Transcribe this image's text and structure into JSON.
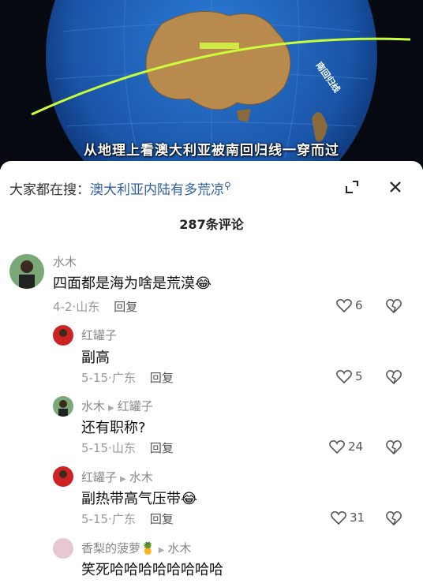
{
  "video": {
    "subtitle": "从地理上看澳大利亚被南回归线一穿而过",
    "map_label": "南回归线"
  },
  "search": {
    "prefix": "大家都在搜：",
    "query": "澳大利亚内陆有多荒凉"
  },
  "comments_count": "287条评论",
  "comments": [
    {
      "name": "水木",
      "reply_to": "",
      "text": "四面都是海为啥是荒漠",
      "emoji": "😂",
      "date": "4-2",
      "location": "山东",
      "reply": "回复",
      "likes": "6"
    },
    {
      "name": "红罐子",
      "reply_to": "",
      "text": "副高",
      "emoji": "",
      "date": "5-15",
      "location": "广东",
      "reply": "回复",
      "likes": "5"
    },
    {
      "name": "水木",
      "reply_to": "红罐子",
      "text": "还有职称?",
      "emoji": "",
      "date": "5-15",
      "location": "山东",
      "reply": "回复",
      "likes": "24"
    },
    {
      "name": "红罐子",
      "reply_to": "水木",
      "text": "副热带高气压带",
      "emoji": "😂",
      "date": "5-15",
      "location": "广东",
      "reply": "回复",
      "likes": "31"
    },
    {
      "name": "香梨的菠萝🍍",
      "reply_to": "水木",
      "text": "笑死哈哈哈哈哈哈哈哈",
      "emoji": "",
      "date": "",
      "location": "",
      "reply": "",
      "likes": ""
    }
  ],
  "colors": {
    "link": "#2f5f9e",
    "tropic_line": "#c8ff3a",
    "ocean": "#1b5fb8",
    "land": "#b98a4e"
  }
}
